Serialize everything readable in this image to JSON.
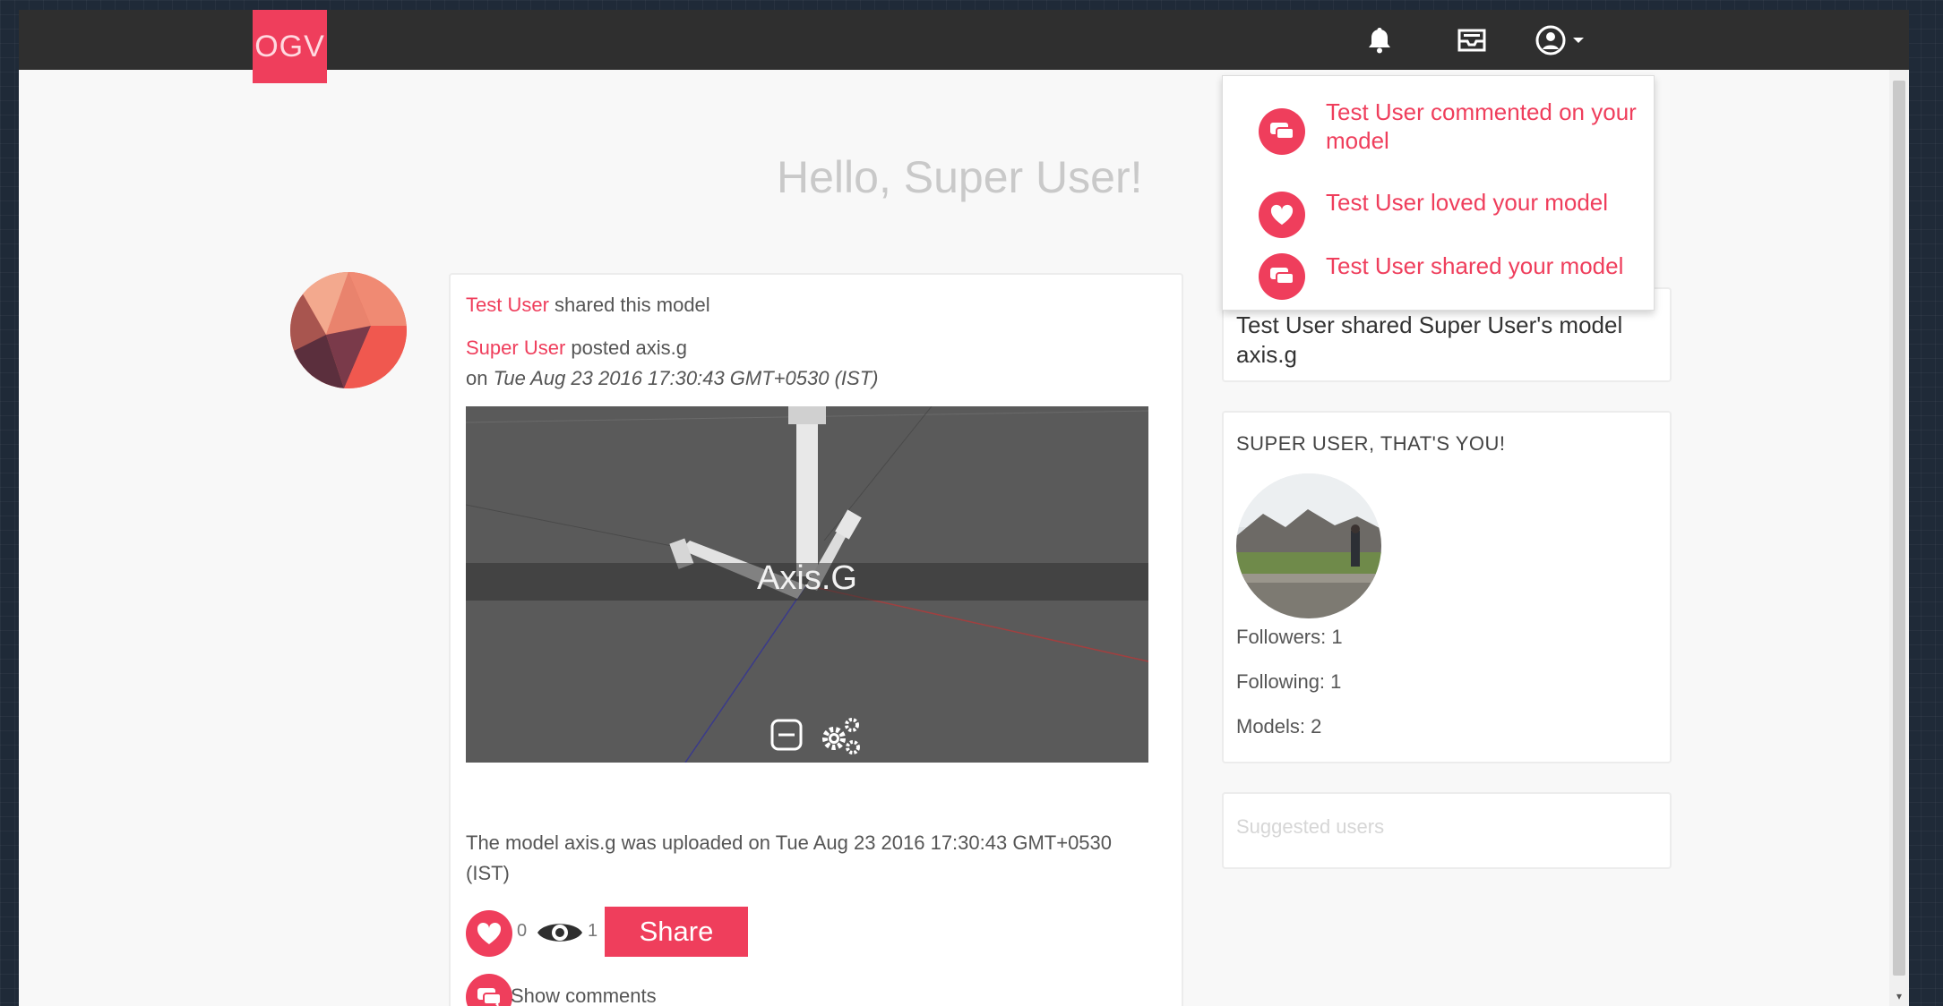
{
  "brand": {
    "logo_text": "OGV"
  },
  "navbar": {
    "icons": [
      "bell-icon",
      "inbox-icon",
      "user-icon",
      "caret-down-icon"
    ]
  },
  "greeting": "Hello, Super User!",
  "feed": {
    "shared_by": "Test User",
    "shared_text": " shared this model",
    "poster": "Super User",
    "posted_text": " posted axis.g",
    "on_prefix": "on ",
    "date": "Tue Aug 23 2016 17:30:43 GMT+0530 (IST)",
    "viewer_title": "Axis.G",
    "description": "The model axis.g was uploaded on Tue Aug 23 2016 17:30:43 GMT+0530 (IST)",
    "likes": "0",
    "views": "1",
    "share_label": "Share",
    "show_comments": "Show comments"
  },
  "sidebar": {
    "activity": "Test User shared Super User's model axis.g",
    "profile_title": "SUPER USER, THAT'S YOU!",
    "followers": "Followers: 1",
    "following": "Following: 1",
    "models": "Models: 2",
    "suggested": "Suggested users"
  },
  "notifications": [
    {
      "text": "Test User commented on your model",
      "icon": "comment-icon"
    },
    {
      "text": "Test User loved your model",
      "icon": "heart-icon"
    },
    {
      "text": "Test User shared your model",
      "icon": "comment-icon"
    }
  ],
  "colors": {
    "accent": "#ef3e5c",
    "navbar": "#2f2f2f",
    "page": "#f8f8f8"
  }
}
